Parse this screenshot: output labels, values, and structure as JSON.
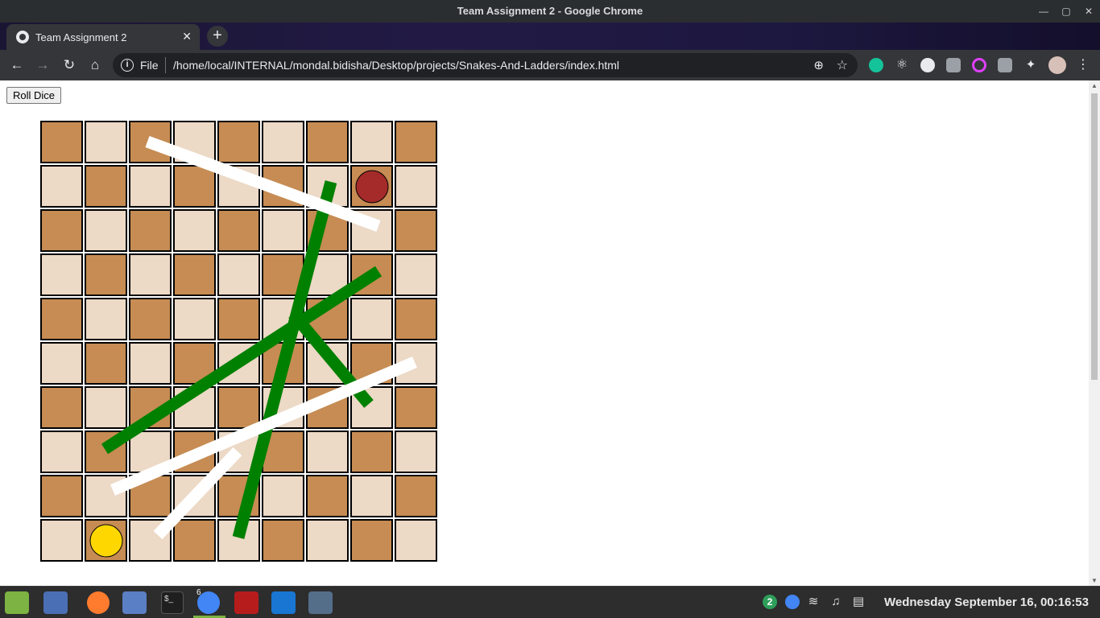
{
  "window": {
    "title": "Team Assignment 2 - Google Chrome"
  },
  "tab": {
    "title": "Team Assignment 2",
    "close": "✕",
    "new_tab": "+"
  },
  "toolbar": {
    "scheme": "File",
    "url": "/home/local/INTERNAL/mondal.bidisha/Desktop/projects/Snakes-And-Ladders/index.html"
  },
  "page": {
    "roll_button": "Roll Dice",
    "board": {
      "rows": 10,
      "cols": 9,
      "colors": {
        "dark": "#c68c53",
        "light": "#ecd9c6",
        "border": "#000000"
      },
      "ladder_color": "#008000",
      "snake_color": "#ffffff",
      "players": [
        {
          "name": "red",
          "color": "#a52a2a",
          "row": 2,
          "col": 8
        },
        {
          "name": "yellow",
          "color": "#ffd700",
          "row": 10,
          "col": 2
        }
      ]
    }
  },
  "taskbar": {
    "clock": "Wednesday September 16, 00:16:53",
    "notification_count": "2",
    "chrome_windows": "6"
  }
}
